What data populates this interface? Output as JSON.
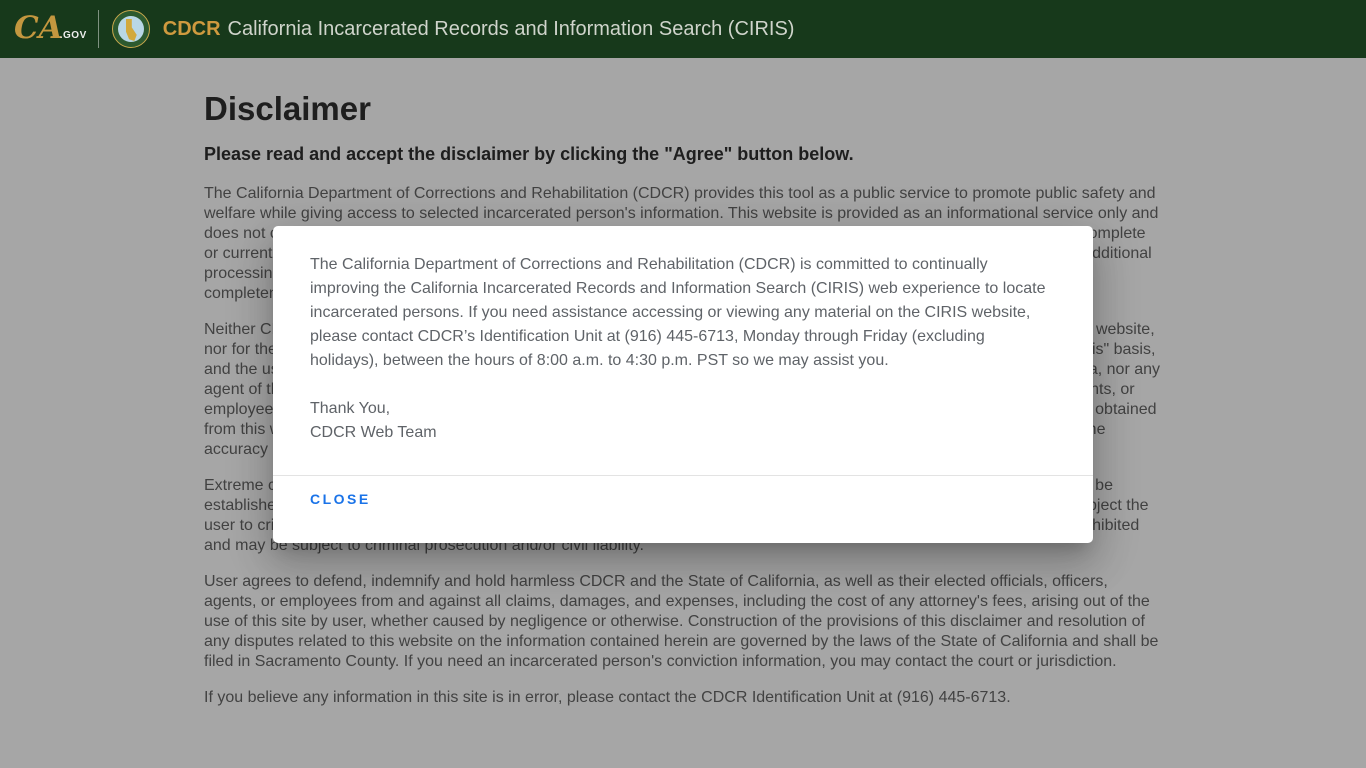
{
  "header": {
    "logo": {
      "ca": "CA",
      "gov": ".GOV"
    },
    "brand": "CDCR",
    "title": "California Incarcerated Records and Information Search (CIRIS)"
  },
  "page": {
    "heading": "Disclaimer",
    "subheading": "Please read and accept the disclaimer by clicking the \"Agree\" button below.",
    "paragraphs": [
      "The California Department of Corrections and Rehabilitation (CDCR) provides this tool as a public service to promote public safety and welfare while giving access to selected incarcerated person's information. This website is provided as an informational service only and does not constitute, and should not be relied upon as, an official record of CDCR. It may contain errors and may not include complete or current information. Data such as court-ordered commitments, county, admitted dates, or conviction information may take additional processing time before appearing on this site. CDCR makes no guarantee, either expressed or implied, as to the accuracy, completeness, or timeliness of the information contained in this website.",
      "Neither CDCR nor the State of California accepts any responsibility or liability for any errors or omissions in the content of this website, nor for the use or misuse of the information contained herein by the user. All information on this website is provided on an \"as is\" basis, and the user shall assume all risks and responsibility associated with the use of this site. Neither CDCR, the State of California, nor any agent of the user, may be held liable for any loss or damage; nor shall the State of California, its elected officials, officers, agents, or employees be liable for any claims, damages, or losses of any kind arising out of the use of, or reliance upon, any information obtained from this website. CDCR, the State of California, and any employees thereof, make no warranty, expressed or implied, as to the accuracy of the information contained herein.",
      "Extreme care should be exercised when using this website to identify an incarcerated person, as positive identification cannot be established by relying solely upon name, age, or other physical descriptions. Misuse of the information in this website may subject the user to criminal prosecution and/or civil liability.Unauthorized attempts to change the information in this website are strictly prohibited and may be subject to criminal prosecution and/or civil liability.",
      "User agrees to defend, indemnify and hold harmless CDCR and the State of California, as well as their elected officials, officers, agents, or employees from and against all claims, damages, and expenses, including the cost of any attorney's fees, arising out of the use of this site by user, whether caused by negligence or otherwise. Construction of the provisions of this disclaimer and resolution of any disputes related to this website on the information contained herein are governed by the laws of the State of California and shall be filed in Sacramento County. If you need an incarcerated person's conviction information, you may contact the court or jurisdiction.",
      "If you believe any information in this site is in error, please contact the CDCR Identification Unit at (916) 445-6713."
    ]
  },
  "modal": {
    "body": "The California Department of Corrections and Rehabilitation (CDCR) is committed to continually improving the California Incarcerated Records and Information Search (CIRIS) web experience to locate incarcerated persons. If you need assistance accessing or viewing any material on the CIRIS website, please contact CDCR’s Identification Unit at (916) 445-6713, Monday through Friday (excluding holidays), between the hours of 8:00 a.m. to 4:30 p.m. PST so we may assist you.",
    "signoff": [
      "Thank You,",
      "CDCR Web Team"
    ],
    "close_label": "CLOSE"
  },
  "colors": {
    "header_bg": "#17391b",
    "brand_gold": "#cf9a3f",
    "close_blue": "#1a73e8"
  }
}
